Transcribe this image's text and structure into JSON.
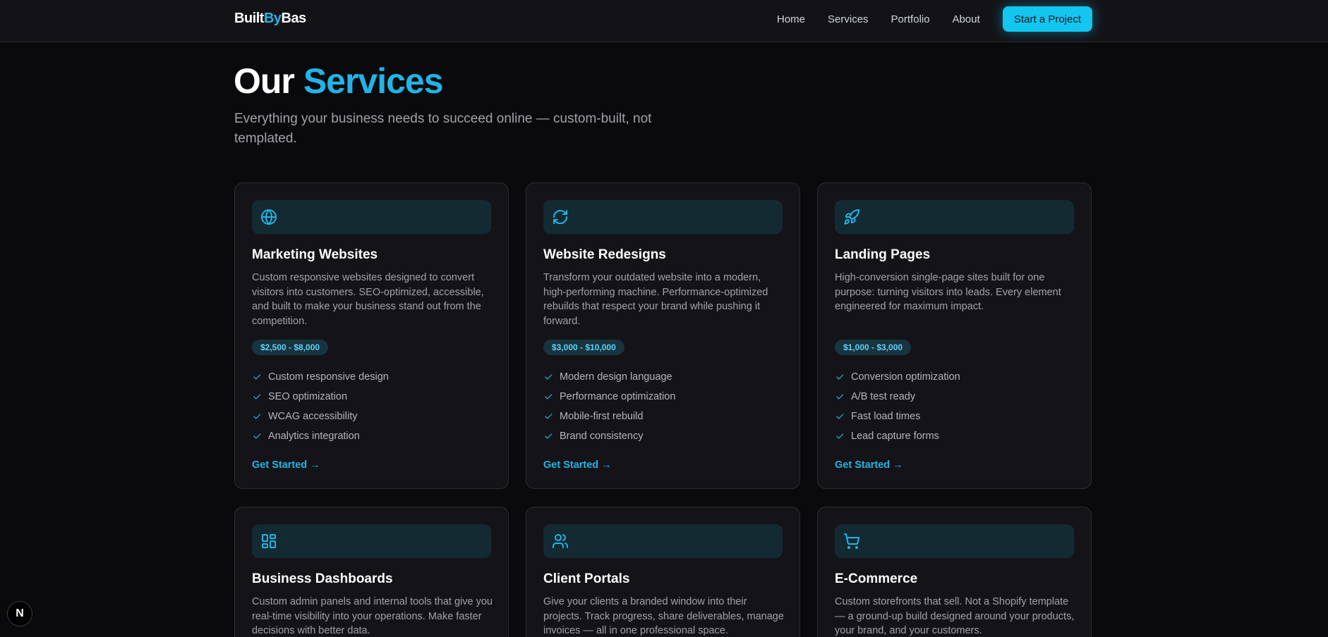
{
  "brand": {
    "name_part1": "Built",
    "name_accent": "By",
    "name_part2": "Bas"
  },
  "nav": {
    "links": [
      "Home",
      "Services",
      "Portfolio",
      "About"
    ],
    "cta": "Start a Project"
  },
  "hero": {
    "title_plain": "Our",
    "title_accent": "Services",
    "subtitle": "Everything your business needs to succeed online — custom-built, not templated."
  },
  "colors": {
    "accent": "#22b4e6",
    "cta_bg": "#12c6f0",
    "background": "#0a0a0d",
    "card_bg": "#141418"
  },
  "cards": [
    {
      "icon": "globe-icon",
      "title": "Marketing Websites",
      "description": "Custom responsive websites designed to convert visitors into customers. SEO-optimized, accessible, and built to make your business stand out from the competition.",
      "price": "$2,500 - $8,000",
      "features": [
        "Custom responsive design",
        "SEO optimization",
        "WCAG accessibility",
        "Analytics integration"
      ],
      "link": "Get Started →"
    },
    {
      "icon": "refresh-icon",
      "title": "Website Redesigns",
      "description": "Transform your outdated website into a modern, high-performing machine. Performance-optimized rebuilds that respect your brand while pushing it forward.",
      "price": "$3,000 - $10,000",
      "features": [
        "Modern design language",
        "Performance optimization",
        "Mobile-first rebuild",
        "Brand consistency"
      ],
      "link": "Get Started →"
    },
    {
      "icon": "rocket-icon",
      "title": "Landing Pages",
      "description": "High-conversion single-page sites built for one purpose: turning visitors into leads. Every element engineered for maximum impact.",
      "price": "$1,000 - $3,000",
      "features": [
        "Conversion optimization",
        "A/B test ready",
        "Fast load times",
        "Lead capture forms"
      ],
      "link": "Get Started →"
    },
    {
      "icon": "dashboard-icon",
      "title": "Business Dashboards",
      "description": "Custom admin panels and internal tools that give you real-time visibility into your operations. Make faster decisions with better data."
    },
    {
      "icon": "users-icon",
      "title": "Client Portals",
      "description": "Give your clients a branded window into their projects. Track progress, share deliverables, manage invoices — all in one professional space."
    },
    {
      "icon": "cart-icon",
      "title": "E-Commerce",
      "description": "Custom storefronts that sell. Not a Shopify template — a ground-up build designed around your products, your brand, and your customers."
    }
  ],
  "dev_badge": "N"
}
